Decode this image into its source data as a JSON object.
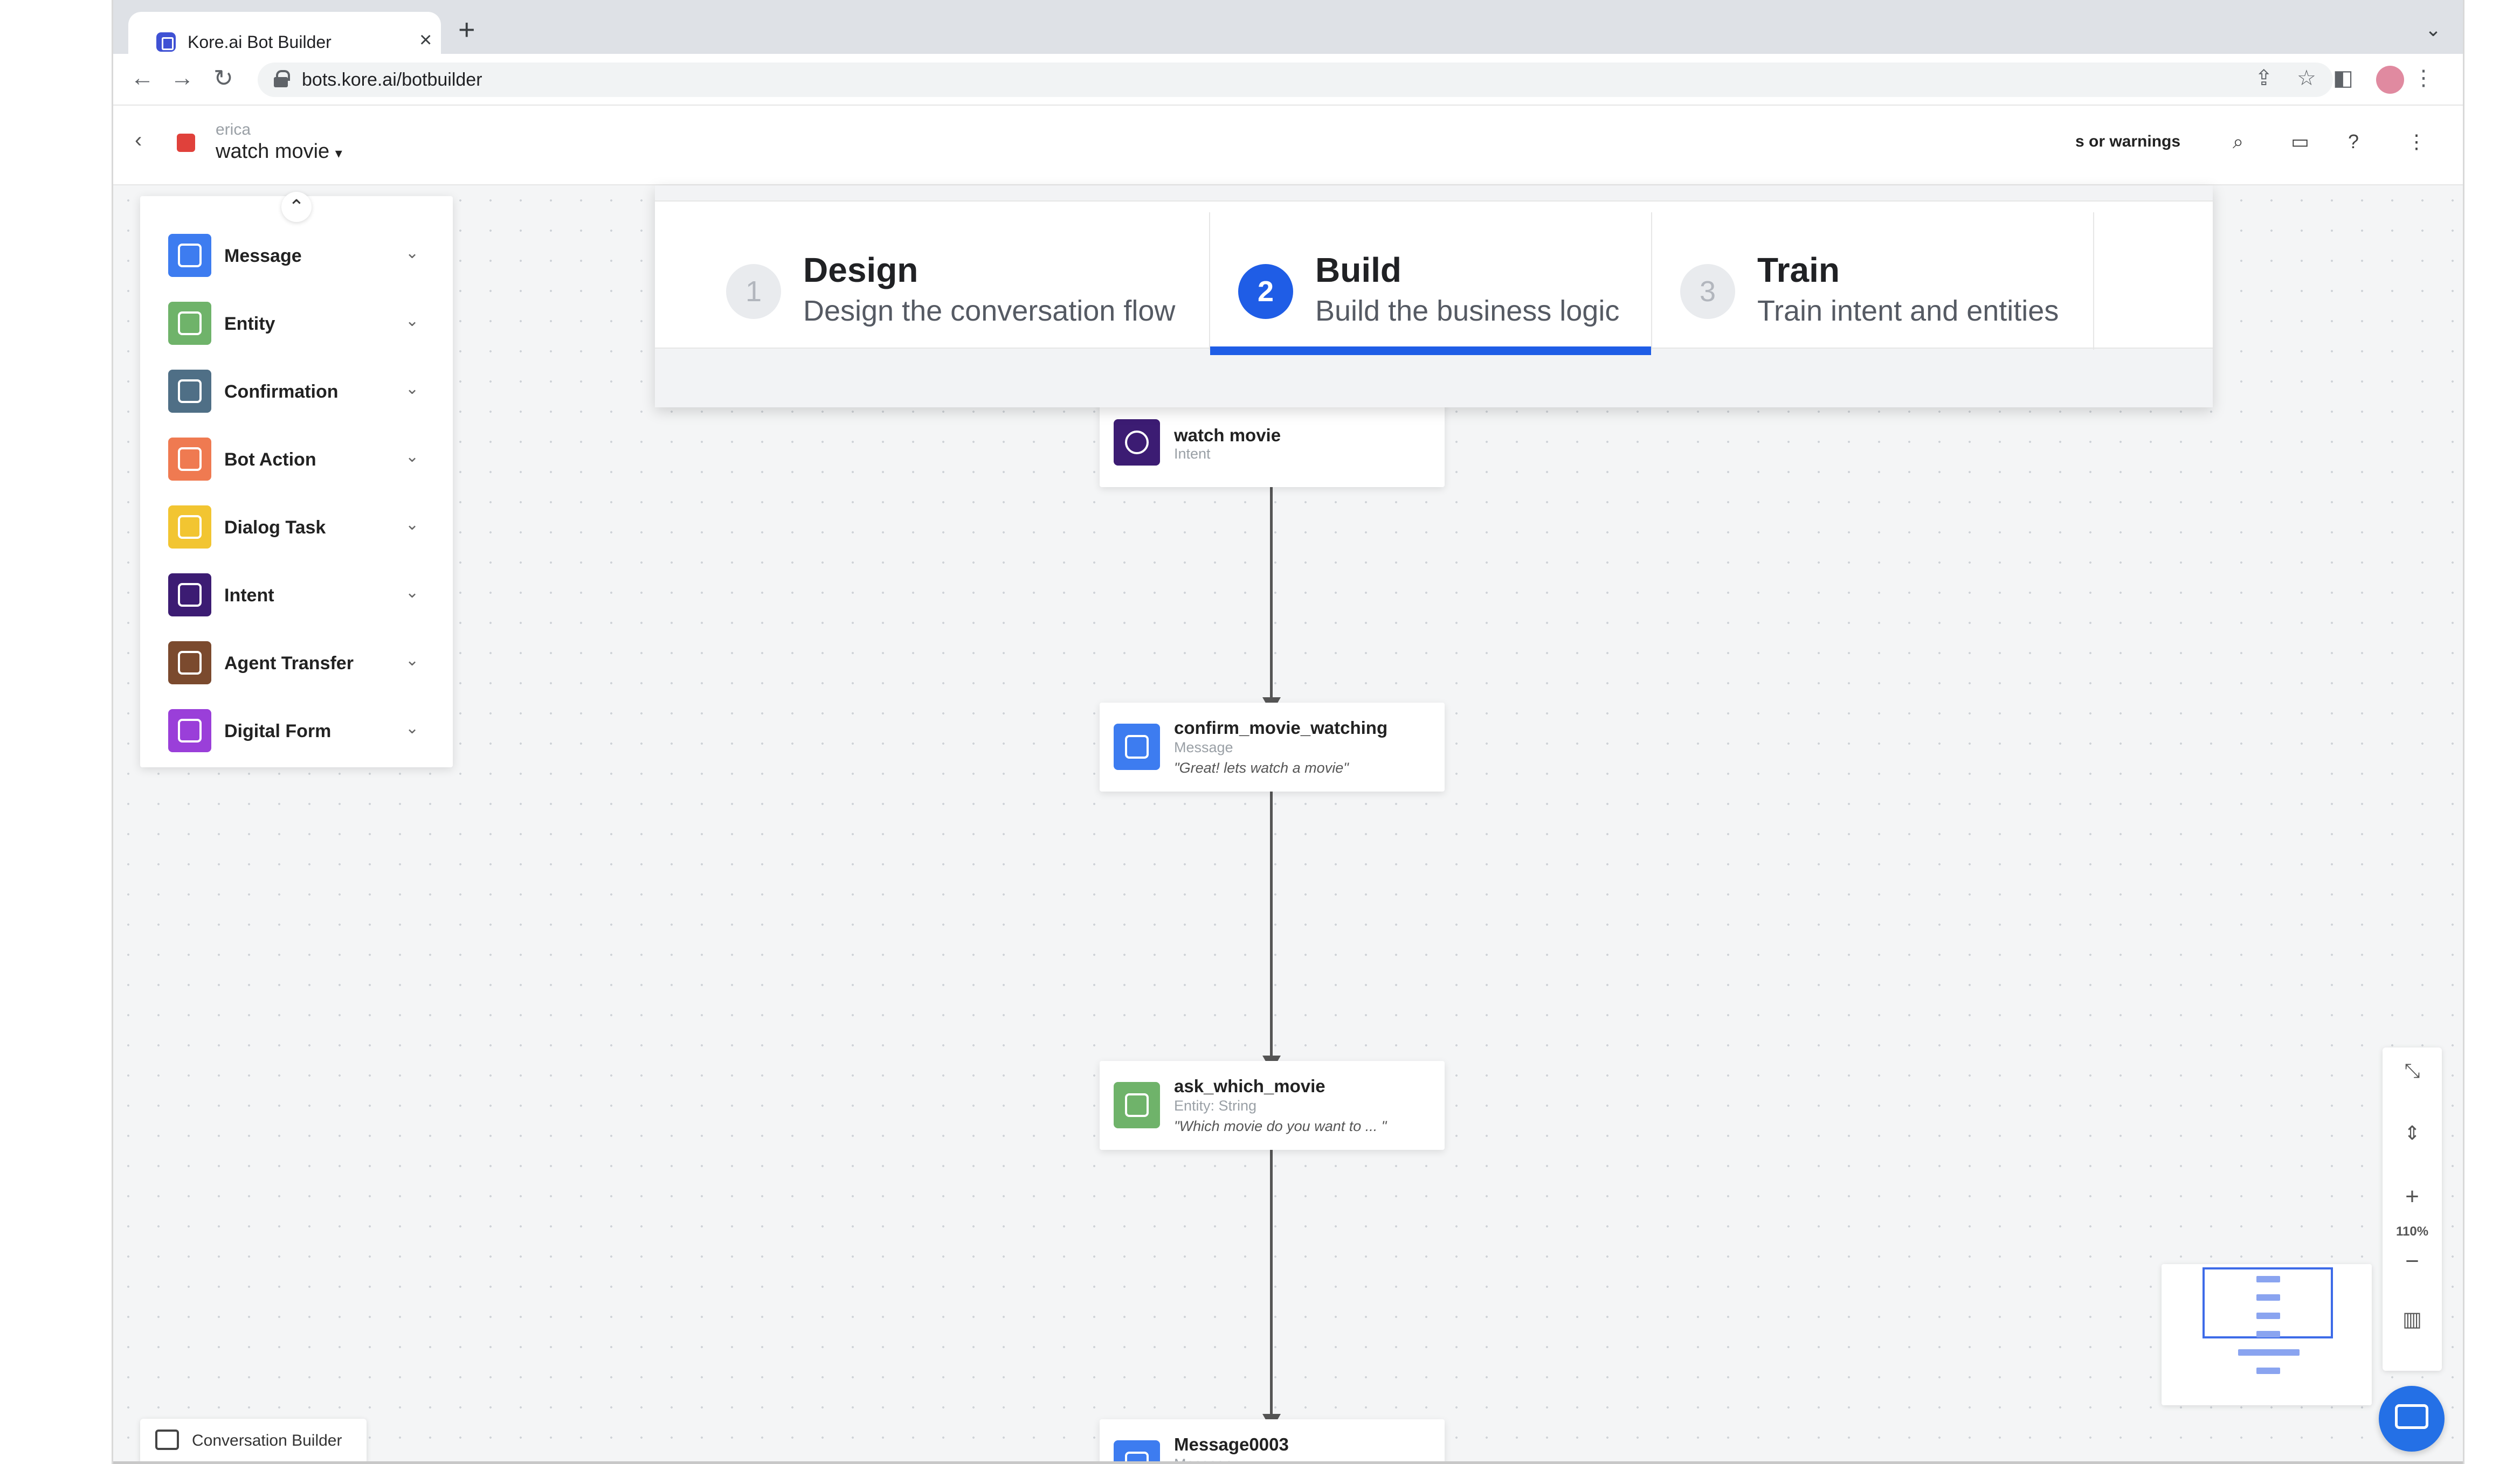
{
  "browser": {
    "tab_title": "Kore.ai Bot Builder",
    "url": "bots.kore.ai/botbuilder"
  },
  "app_header": {
    "bot_owner": "erica",
    "bot_name": "watch movie",
    "warnings_label": "s or warnings"
  },
  "steps": [
    {
      "number": "1",
      "title": "Design",
      "subtitle": "Design the conversation flow",
      "active": false
    },
    {
      "number": "2",
      "title": "Build",
      "subtitle": "Build the business logic",
      "active": true
    },
    {
      "number": "3",
      "title": "Train",
      "subtitle": "Train intent and entities",
      "active": false
    }
  ],
  "palette": [
    {
      "label": "Message",
      "icon": "message-icon",
      "color": "#3d7cf0"
    },
    {
      "label": "Entity",
      "icon": "entity-icon",
      "color": "#6fb36a"
    },
    {
      "label": "Confirmation",
      "icon": "confirmation-icon",
      "color": "#4f6f86"
    },
    {
      "label": "Bot Action",
      "icon": "bot-action-icon",
      "color": "#ef7a51"
    },
    {
      "label": "Dialog Task",
      "icon": "dialog-task-icon",
      "color": "#f2c531"
    },
    {
      "label": "Intent",
      "icon": "intent-icon",
      "color": "#3c1c73"
    },
    {
      "label": "Agent Transfer",
      "icon": "agent-transfer-icon",
      "color": "#7b4a2e"
    },
    {
      "label": "Digital Form",
      "icon": "digital-form-icon",
      "color": "#9a3fd9"
    }
  ],
  "nodes": [
    {
      "title": "watch movie",
      "type": "Intent",
      "message": "",
      "color": "#3c1c73"
    },
    {
      "title": "confirm_movie_watching",
      "type": "Message",
      "message": "\"Great! lets watch a movie\"",
      "color": "#3d7cf0"
    },
    {
      "title": "ask_which_movie",
      "type": "Entity: String",
      "message": "\"Which movie do you want to ... \"",
      "color": "#6fb36a"
    },
    {
      "title": "Message0003",
      "type": "Message",
      "message": "",
      "color": "#3d7cf0"
    }
  ],
  "zoom": {
    "level": "110%"
  },
  "footer": {
    "conversation_builder": "Conversation Builder"
  },
  "colors": {
    "accent": "#1f5de6"
  }
}
